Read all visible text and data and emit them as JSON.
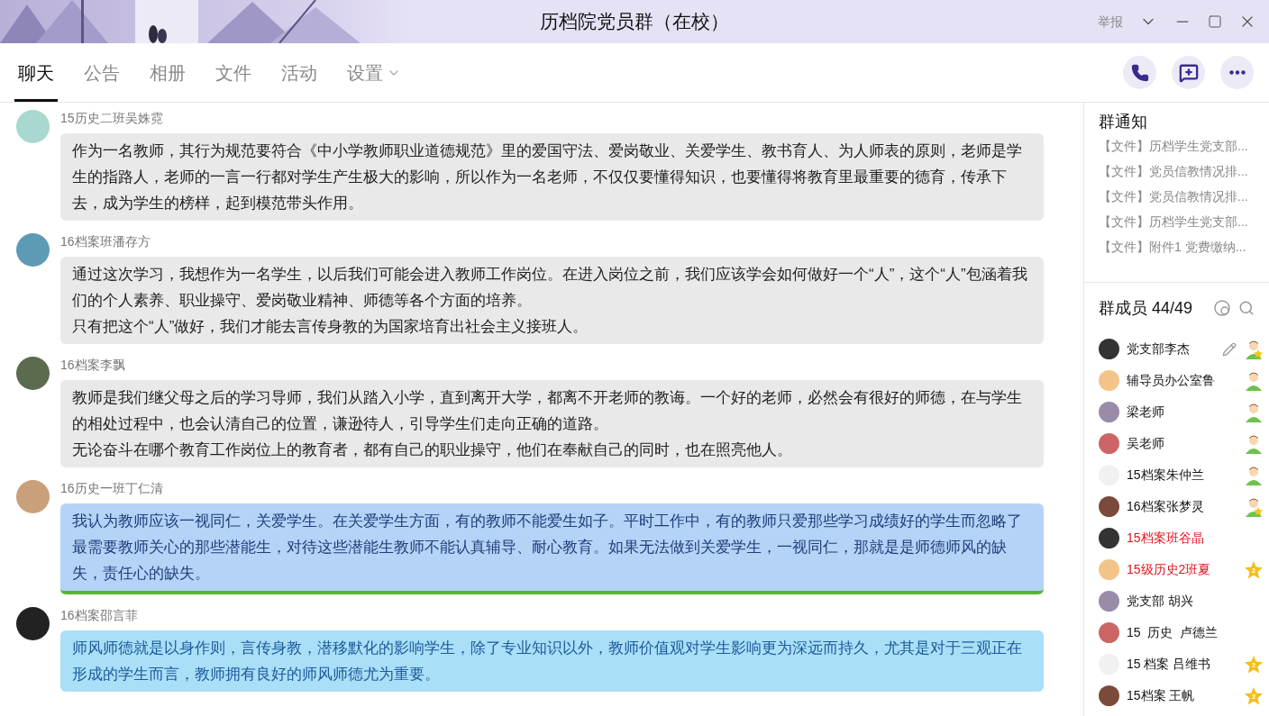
{
  "window": {
    "title": "历档院党员群（在校）",
    "report": "举报"
  },
  "tabs": [
    {
      "label": "聊天",
      "selected": true,
      "dropdown": false
    },
    {
      "label": "公告",
      "selected": false,
      "dropdown": false
    },
    {
      "label": "相册",
      "selected": false,
      "dropdown": false
    },
    {
      "label": "文件",
      "selected": false,
      "dropdown": false
    },
    {
      "label": "活动",
      "selected": false,
      "dropdown": false
    },
    {
      "label": "设置",
      "selected": false,
      "dropdown": true
    }
  ],
  "messages": [
    {
      "sender": "15历史二班吴姝霓",
      "kind": "gray",
      "paragraphs": [
        "作为一名教师，其行为规范要符合《中小学教师职业道德规范》里的爱国守法、爱岗敬业、关爱学生、教书育人、为人师表的原则，老师是学生的指路人，老师的一言一行都对学生产生极大的影响，所以作为一名老师，不仅仅要懂得知识，也要懂得将教育里最重要的德育，传承下去，成为学生的榜样，起到模范带头作用。"
      ]
    },
    {
      "sender": "16档案班潘存方",
      "kind": "gray",
      "paragraphs": [
        "通过这次学习，我想作为一名学生，以后我们可能会进入教师工作岗位。在进入岗位之前，我们应该学会如何做好一个“人”，这个“人”包涵着我们的个人素养、职业操守、爱岗敬业精神、师德等各个方面的培养。",
        "只有把这个“人”做好，我们才能去言传身教的为国家培育出社会主义接班人。"
      ]
    },
    {
      "sender": "16档案李飘",
      "kind": "gray",
      "paragraphs": [
        "教师是我们继父母之后的学习导师，我们从踏入小学，直到离开大学，都离不开老师的教诲。一个好的老师，必然会有很好的师德，在与学生的相处过程中，也会认清自己的位置，谦逊待人，引导学生们走向正确的道路。",
        "无论奋斗在哪个教育工作岗位上的教育者，都有自己的职业操守，他们在奉献自己的同时，也在照亮他人。"
      ]
    },
    {
      "sender": "16历史一班丁仁清",
      "kind": "blue",
      "paragraphs": [
        "我认为教师应该一视同仁，关爱学生。在关爱学生方面，有的教师不能爱生如子。平时工作中，有的教师只爱那些学习成绩好的学生而忽略了最需要教师关心的那些潜能生，对待这些潜能生教师不能认真辅导、耐心教育。如果无法做到关爱学生，一视同仁，那就是是师德师风的缺失，责任心的缺失。"
      ]
    },
    {
      "sender": "16档案邵言菲",
      "kind": "cyan",
      "paragraphs": [
        "师风师德就是以身作则，言传身教，潜移默化的影响学生，除了专业知识以外，教师价值观对学生影响更为深远而持久，尤其是对于三观正在形成的学生而言，教师拥有良好的师风师德尤为重要。"
      ]
    }
  ],
  "notices": {
    "title": "群通知",
    "items": [
      "【文件】历档学生党支部...",
      "【文件】党员信教情况排...",
      "【文件】党员信教情况排...",
      "【文件】历档学生党支部...",
      "【文件】附件1  党费缴纳..."
    ]
  },
  "members": {
    "title": "群成员 44/49",
    "items": [
      {
        "name": "党支部李杰",
        "kind": "admin",
        "edit": true
      },
      {
        "name": "辅导员办公室鲁",
        "kind": "member",
        "edit": false
      },
      {
        "name": "梁老师",
        "kind": "member",
        "edit": false
      },
      {
        "name": "吴老师",
        "kind": "member",
        "edit": false
      },
      {
        "name": "15档案朱仲兰",
        "kind": "member",
        "edit": false
      },
      {
        "name": "16档案张梦灵",
        "kind": "admin",
        "edit": false
      },
      {
        "name": "15档案班谷晶",
        "color": "#e0141e",
        "kind": "plain",
        "edit": false
      },
      {
        "name": "15级历史2班夏",
        "color": "#e0141e",
        "kind": "level",
        "level_label": "2",
        "edit": false
      },
      {
        "name": "党支部 胡兴",
        "kind": "plain",
        "edit": false
      },
      {
        "name": "15  历史  卢德兰",
        "kind": "plain",
        "edit": false
      },
      {
        "name": "15 档案 吕维书",
        "kind": "level",
        "level_label": "2",
        "edit": false
      },
      {
        "name": "15档案 王帆",
        "kind": "level",
        "level_label": "2",
        "edit": false
      }
    ]
  }
}
